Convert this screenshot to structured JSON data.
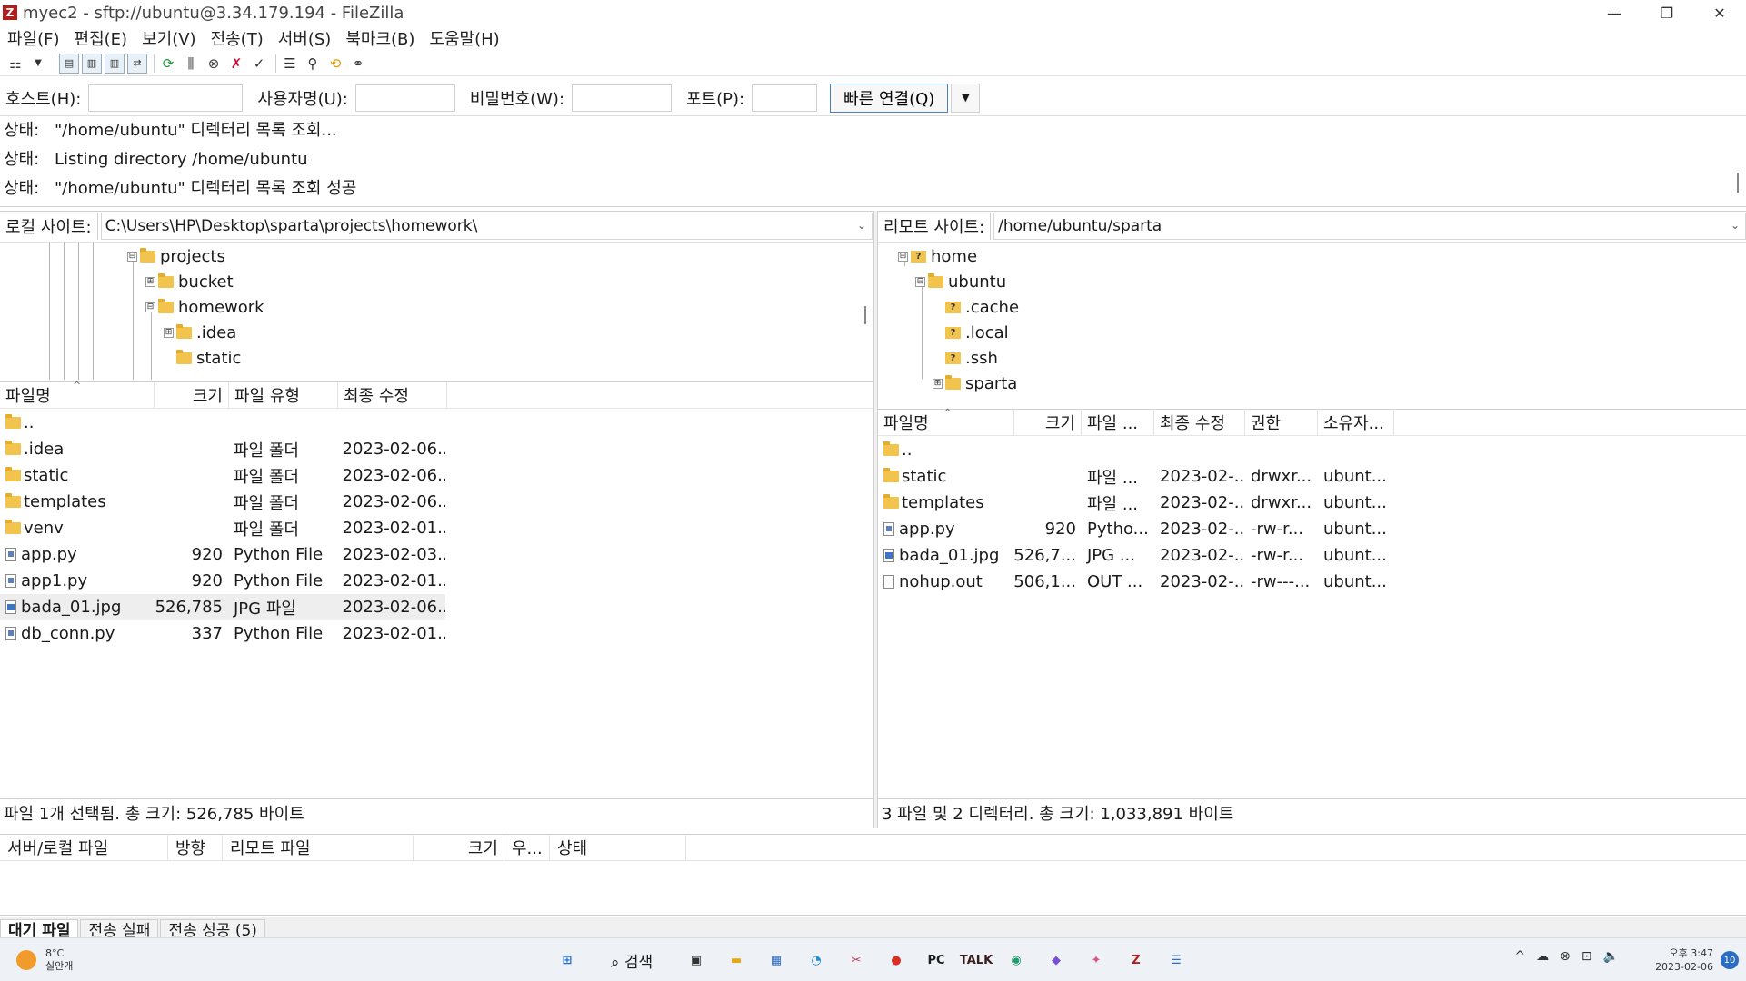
{
  "window": {
    "title": "myec2 - sftp://ubuntu@3.34.179.194 - FileZilla",
    "app_icon": "Z",
    "minimize": "—",
    "maximize": "❐",
    "close": "✕"
  },
  "menu": [
    "파일(F)",
    "편집(E)",
    "보기(V)",
    "전송(T)",
    "서버(S)",
    "북마크(B)",
    "도움말(H)"
  ],
  "toolbar_icons": [
    "site-manager-icon",
    "dropdown-icon",
    "toggle-log-icon",
    "toggle-local-tree-icon",
    "toggle-remote-tree-icon",
    "toggle-queue-icon",
    "refresh-icon",
    "process-queue-icon",
    "cancel-icon",
    "disconnect-icon",
    "reconnect-icon",
    "filter-icon",
    "compare-icon",
    "sync-browse-icon",
    "search-icon"
  ],
  "quickconnect": {
    "host_label": "호스트(H):",
    "host_value": "",
    "user_label": "사용자명(U):",
    "user_value": "",
    "pass_label": "비밀번호(W):",
    "pass_value": "",
    "port_label": "포트(P):",
    "port_value": "",
    "button": "빠른 연결(Q)",
    "dropdown": "▼"
  },
  "log": [
    {
      "label": "상태:",
      "text": "\"/home/ubuntu\" 디렉터리 목록 조회..."
    },
    {
      "label": "상태:",
      "text": "Listing directory /home/ubuntu"
    },
    {
      "label": "상태:",
      "text": "\"/home/ubuntu\" 디렉터리 목록 조회 성공"
    }
  ],
  "local": {
    "site_label": "로컬 사이트:",
    "path": "C:\\Users\\HP\\Desktop\\sparta\\projects\\homework\\",
    "tree": [
      {
        "name": "projects",
        "expander": "⊟"
      },
      {
        "name": "bucket",
        "expander": "⊞"
      },
      {
        "name": "homework",
        "expander": "⊟"
      },
      {
        "name": ".idea",
        "expander": "⊞"
      },
      {
        "name": "static",
        "expander": ""
      }
    ],
    "columns": {
      "name": "파일명",
      "size": "크기",
      "type": "파일 유형",
      "modified": "최종 수정"
    },
    "sort_indicator": "^",
    "files": [
      {
        "name": "..",
        "icon": "folder",
        "size": "",
        "type": "",
        "modified": "",
        "selected": false
      },
      {
        "name": ".idea",
        "icon": "folder",
        "size": "",
        "type": "파일 폴더",
        "modified": "2023-02-06...",
        "selected": false
      },
      {
        "name": "static",
        "icon": "folder",
        "size": "",
        "type": "파일 폴더",
        "modified": "2023-02-06...",
        "selected": false
      },
      {
        "name": "templates",
        "icon": "folder",
        "size": "",
        "type": "파일 폴더",
        "modified": "2023-02-06...",
        "selected": false
      },
      {
        "name": "venv",
        "icon": "folder",
        "size": "",
        "type": "파일 폴더",
        "modified": "2023-02-01...",
        "selected": false
      },
      {
        "name": "app.py",
        "icon": "py",
        "size": "920",
        "type": "Python File",
        "modified": "2023-02-03...",
        "selected": false
      },
      {
        "name": "app1.py",
        "icon": "py",
        "size": "920",
        "type": "Python File",
        "modified": "2023-02-01...",
        "selected": false
      },
      {
        "name": "bada_01.jpg",
        "icon": "img",
        "size": "526,785",
        "type": "JPG 파일",
        "modified": "2023-02-06...",
        "selected": true
      },
      {
        "name": "db_conn.py",
        "icon": "py",
        "size": "337",
        "type": "Python File",
        "modified": "2023-02-01...",
        "selected": false
      }
    ],
    "status": "파일 1개 선택됨. 총 크기: 526,785 바이트"
  },
  "remote": {
    "site_label": "리모트 사이트:",
    "path": "/home/ubuntu/sparta",
    "tree": [
      {
        "name": "home",
        "expander": "⊟",
        "unknown": true
      },
      {
        "name": "ubuntu",
        "expander": "⊟",
        "unknown": false
      },
      {
        "name": ".cache",
        "expander": "",
        "unknown": true
      },
      {
        "name": ".local",
        "expander": "",
        "unknown": true
      },
      {
        "name": ".ssh",
        "expander": "",
        "unknown": true
      },
      {
        "name": "sparta",
        "expander": "⊞",
        "unknown": false
      }
    ],
    "columns": {
      "name": "파일명",
      "size": "크기",
      "type": "파일 ...",
      "modified": "최종 수정",
      "perm": "권한",
      "owner": "소유자..."
    },
    "sort_indicator": "^",
    "files": [
      {
        "name": "..",
        "icon": "folder",
        "size": "",
        "type": "",
        "modified": "",
        "perm": "",
        "owner": ""
      },
      {
        "name": "static",
        "icon": "folder",
        "size": "",
        "type": "파일 ...",
        "modified": "2023-02-...",
        "perm": "drwxr...",
        "owner": "ubunt..."
      },
      {
        "name": "templates",
        "icon": "folder",
        "size": "",
        "type": "파일 ...",
        "modified": "2023-02-...",
        "perm": "drwxr...",
        "owner": "ubunt..."
      },
      {
        "name": "app.py",
        "icon": "py",
        "size": "920",
        "type": "Pytho...",
        "modified": "2023-02-...",
        "perm": "-rw-r...",
        "owner": "ubunt..."
      },
      {
        "name": "bada_01.jpg",
        "icon": "img",
        "size": "526,7...",
        "type": "JPG ...",
        "modified": "2023-02-...",
        "perm": "-rw-r...",
        "owner": "ubunt..."
      },
      {
        "name": "nohup.out",
        "icon": "file",
        "size": "506,1...",
        "type": "OUT ...",
        "modified": "2023-02-...",
        "perm": "-rw---...",
        "owner": "ubunt..."
      }
    ],
    "status": "3 파일 및 2 디렉터리. 총 크기: 1,033,891 바이트"
  },
  "queue": {
    "columns": [
      "서버/로컬 파일",
      "방향",
      "리모트 파일",
      "크기",
      "우...",
      "상태"
    ],
    "tabs": [
      "대기 파일",
      "전송 실패",
      "전송 성공 (5)"
    ]
  },
  "taskbar": {
    "weather_temp": "8°C",
    "weather_desc": "실안개",
    "search_label": "⌕ 검색",
    "apps": [
      {
        "name": "start",
        "glyph": "⊞",
        "color": "#1f6fd1"
      },
      {
        "name": "search",
        "glyph": "",
        "color": ""
      },
      {
        "name": "task-view",
        "glyph": "▣",
        "color": "#333333"
      },
      {
        "name": "file-explorer",
        "glyph": "▬",
        "color": "#e6a817"
      },
      {
        "name": "store",
        "glyph": "▦",
        "color": "#2b6cc4"
      },
      {
        "name": "edge",
        "glyph": "◔",
        "color": "#1a8fd8"
      },
      {
        "name": "snipping",
        "glyph": "✂",
        "color": "#c4314b"
      },
      {
        "name": "chrome",
        "glyph": "●",
        "color": "#d93025"
      },
      {
        "name": "pycharm",
        "glyph": "PC",
        "color": "#1c1c1c"
      },
      {
        "name": "kakaotalk",
        "glyph": "TALK",
        "color": "#3a1d1d"
      },
      {
        "name": "app-green",
        "glyph": "◉",
        "color": "#1e9e6a"
      },
      {
        "name": "app-purple",
        "glyph": "◆",
        "color": "#7b4dd6"
      },
      {
        "name": "app-multi",
        "glyph": "✦",
        "color": "#e0508a"
      },
      {
        "name": "filezilla",
        "glyph": "Z",
        "color": "#b01e1e"
      },
      {
        "name": "notepad",
        "glyph": "☰",
        "color": "#2b6cc4"
      }
    ],
    "tray": [
      "^",
      "☁",
      "⊗",
      "⊡",
      "🔈"
    ],
    "time": "오후 3:47",
    "date": "2023-02-06",
    "notification_count": "10"
  }
}
